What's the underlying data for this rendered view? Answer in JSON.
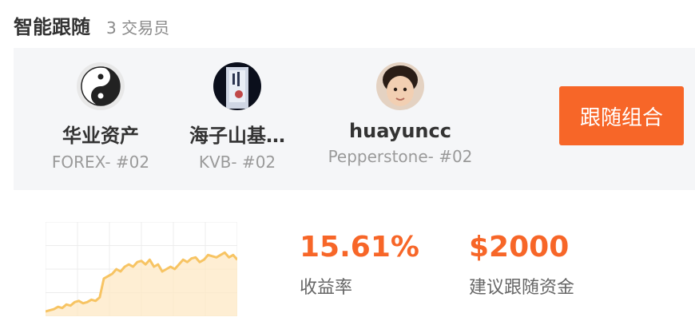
{
  "header": {
    "title": "智能跟随",
    "count": "3 交易员"
  },
  "traders": [
    {
      "name": "华业资产",
      "broker": "FOREX- #02"
    },
    {
      "name": "海子山基…",
      "broker": "KVB- #02"
    },
    {
      "name": "huayuncc",
      "broker": "Pepperstone- #02"
    }
  ],
  "follow_button": {
    "label": "跟随组合"
  },
  "stats": {
    "return_value": "15.61%",
    "return_label": "收益率",
    "fund_value": "$2000",
    "fund_label": "建议跟随资金"
  },
  "colors": {
    "accent": "#f76628",
    "line": "#f7c463",
    "area": "#fde8c4"
  },
  "chart_data": {
    "type": "area",
    "title": "",
    "xlabel": "",
    "ylabel": "",
    "grid": true,
    "values": [
      2,
      2.5,
      3,
      4,
      3.5,
      5,
      4.5,
      6,
      6.5,
      5.5,
      6,
      7,
      6.5,
      8,
      16,
      17,
      18,
      20,
      19,
      21,
      22,
      21,
      23,
      23.5,
      22,
      24,
      21,
      22,
      19,
      20,
      21,
      20,
      22,
      24,
      23,
      24.5,
      25,
      23,
      24,
      26,
      25.5,
      25,
      26,
      27,
      25,
      26,
      24
    ],
    "ylim": [
      0,
      40
    ]
  }
}
